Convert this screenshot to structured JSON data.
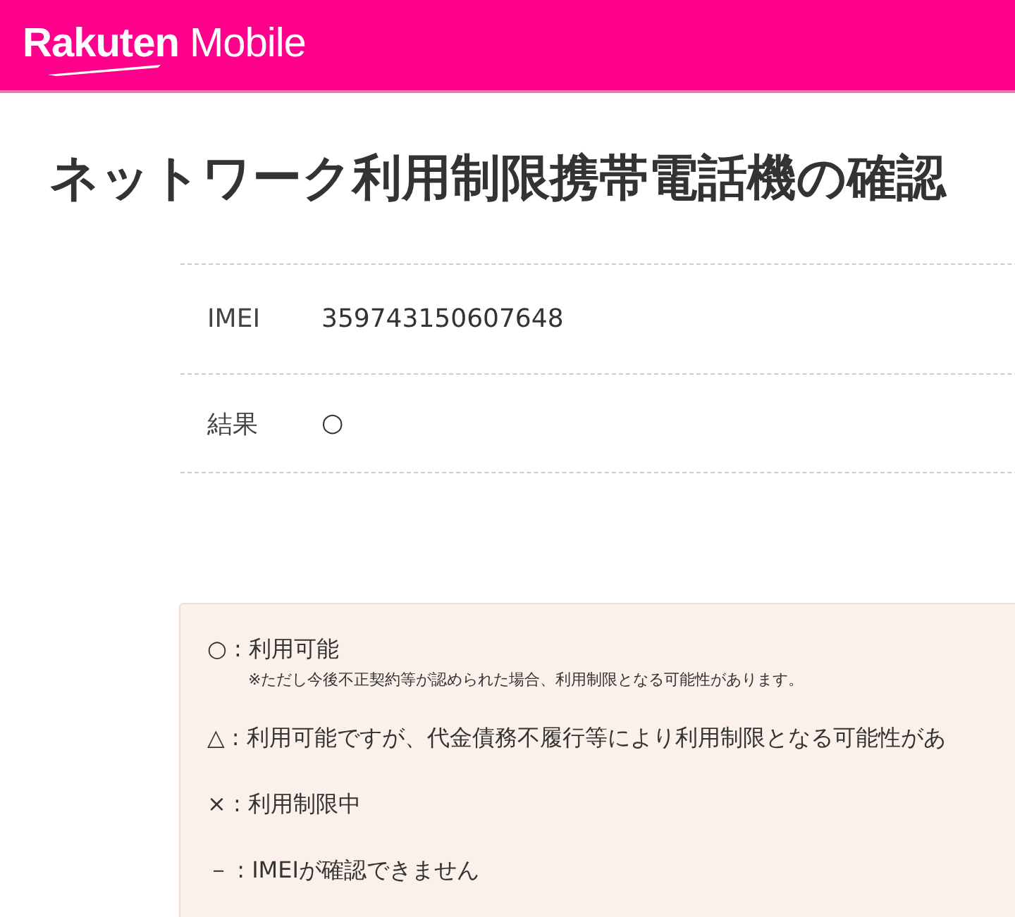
{
  "header": {
    "logo": "**Rakuten** Mobile"
  },
  "title": "ネットワーク利用制限携帯電話機の確認",
  "result_table": {
    "rows": [
      {
        "label": "IMEI",
        "value": "359743150607648"
      },
      {
        "label": "結果",
        "value": "○"
      }
    ]
  },
  "legend": [
    {
      "text": "○ : 利用可能",
      "note": "※ただし今後不正契約等が認められた場合、利用制限となる可能性があります。"
    },
    {
      "text": "△ : 利用可能ですが、代金債務不履行等により利用制限となる可能性があ"
    },
    {
      "text": "× : 利用制限中"
    },
    {
      "text": "－ : IMEIが確認できません"
    }
  ]
}
